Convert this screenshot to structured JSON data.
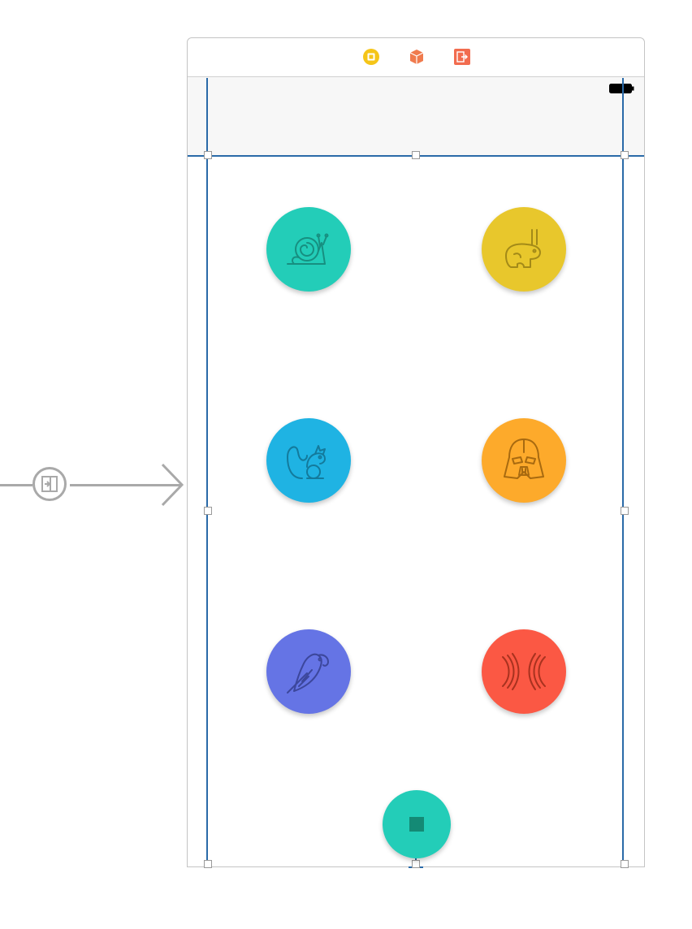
{
  "entry_point": {
    "icon": "storyboard-entry-icon"
  },
  "scene_dock": {
    "icons": [
      {
        "name": "view-controller-icon",
        "color": "#f5c518"
      },
      {
        "name": "first-responder-icon",
        "color": "#f07b4e"
      },
      {
        "name": "exit-icon",
        "color": "#f26c4f"
      }
    ]
  },
  "status_bar": {
    "battery_icon": "battery-icon"
  },
  "buttons": [
    {
      "name": "snail-button",
      "icon": "snail-icon",
      "color": "#23cdb8"
    },
    {
      "name": "rabbit-button",
      "icon": "rabbit-icon",
      "color": "#e8c72c"
    },
    {
      "name": "squirrel-button",
      "icon": "squirrel-icon",
      "color": "#1fb3e3"
    },
    {
      "name": "vader-button",
      "icon": "vader-helmet-icon",
      "color": "#fdaa2b"
    },
    {
      "name": "parrot-button",
      "icon": "parrot-icon",
      "color": "#6574e5"
    },
    {
      "name": "reverse-button",
      "icon": "reverse-waves-icon",
      "color": "#fb5844"
    }
  ],
  "stop_button": {
    "name": "stop-button",
    "icon": "stop-icon",
    "color": "#23cdb8",
    "square_color": "#148a75"
  }
}
